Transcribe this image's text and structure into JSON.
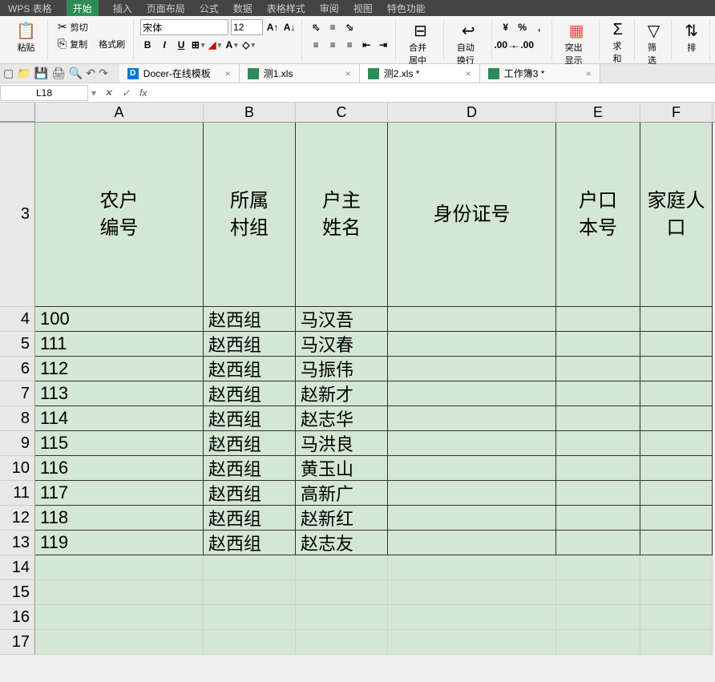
{
  "menu": {
    "items": [
      "WPS 表格",
      "开始",
      "插入",
      "页面布局",
      "公式",
      "数据",
      "表格样式",
      "审阅",
      "视图",
      "特色功能"
    ],
    "active": 1
  },
  "ribbon": {
    "paste": "粘贴",
    "cut": "剪切",
    "copy": "复制",
    "format_painter": "格式刷",
    "font_name": "宋体",
    "font_size": "12",
    "merge_center": "合并居中",
    "wrap_text": "自动换行",
    "currency_symbol": "¥",
    "percent": "%",
    "highlight": "突出显示",
    "sum": "求和",
    "filter": "筛选",
    "sort": "排"
  },
  "qat_tabs": [
    {
      "label": "Docer-在线模板",
      "type": "docer"
    },
    {
      "label": "测1.xls",
      "type": "excel"
    },
    {
      "label": "测2.xls *",
      "type": "excel",
      "active": true
    },
    {
      "label": "工作簿3 *",
      "type": "excel"
    }
  ],
  "formula_bar": {
    "cell_ref": "L18",
    "formula": ""
  },
  "columns": [
    "A",
    "B",
    "C",
    "D",
    "E",
    "F"
  ],
  "header_row_num": "3",
  "headers": {
    "A": "农户\n编号",
    "B": "所属\n村组",
    "C": "户主\n姓名",
    "D": "身份证号",
    "E": "户口\n本号",
    "F": "家庭人\n口"
  },
  "rows": [
    {
      "num": "4",
      "A": "100",
      "B": "赵西组",
      "C": "马汉吾",
      "D": "",
      "E": "",
      "F": ""
    },
    {
      "num": "5",
      "A": "111",
      "B": "赵西组",
      "C": "马汉春",
      "D": "",
      "E": "",
      "F": ""
    },
    {
      "num": "6",
      "A": "112",
      "B": "赵西组",
      "C": "马振伟",
      "D": "",
      "E": "",
      "F": ""
    },
    {
      "num": "7",
      "A": "113",
      "B": "赵西组",
      "C": "赵新才",
      "D": "",
      "E": "",
      "F": ""
    },
    {
      "num": "8",
      "A": "114",
      "B": "赵西组",
      "C": "赵志华",
      "D": "",
      "E": "",
      "F": ""
    },
    {
      "num": "9",
      "A": "115",
      "B": "赵西组",
      "C": "马洪良",
      "D": "",
      "E": "",
      "F": ""
    },
    {
      "num": "10",
      "A": "116",
      "B": "赵西组",
      "C": "黄玉山",
      "D": "",
      "E": "",
      "F": ""
    },
    {
      "num": "11",
      "A": "117",
      "B": "赵西组",
      "C": "高新广",
      "D": "",
      "E": "",
      "F": ""
    },
    {
      "num": "12",
      "A": "118",
      "B": "赵西组",
      "C": "赵新红",
      "D": "",
      "E": "",
      "F": ""
    },
    {
      "num": "13",
      "A": "119",
      "B": "赵西组",
      "C": "赵志友",
      "D": "",
      "E": "",
      "F": ""
    }
  ],
  "empty_rows": [
    "14",
    "15",
    "16",
    "17"
  ]
}
